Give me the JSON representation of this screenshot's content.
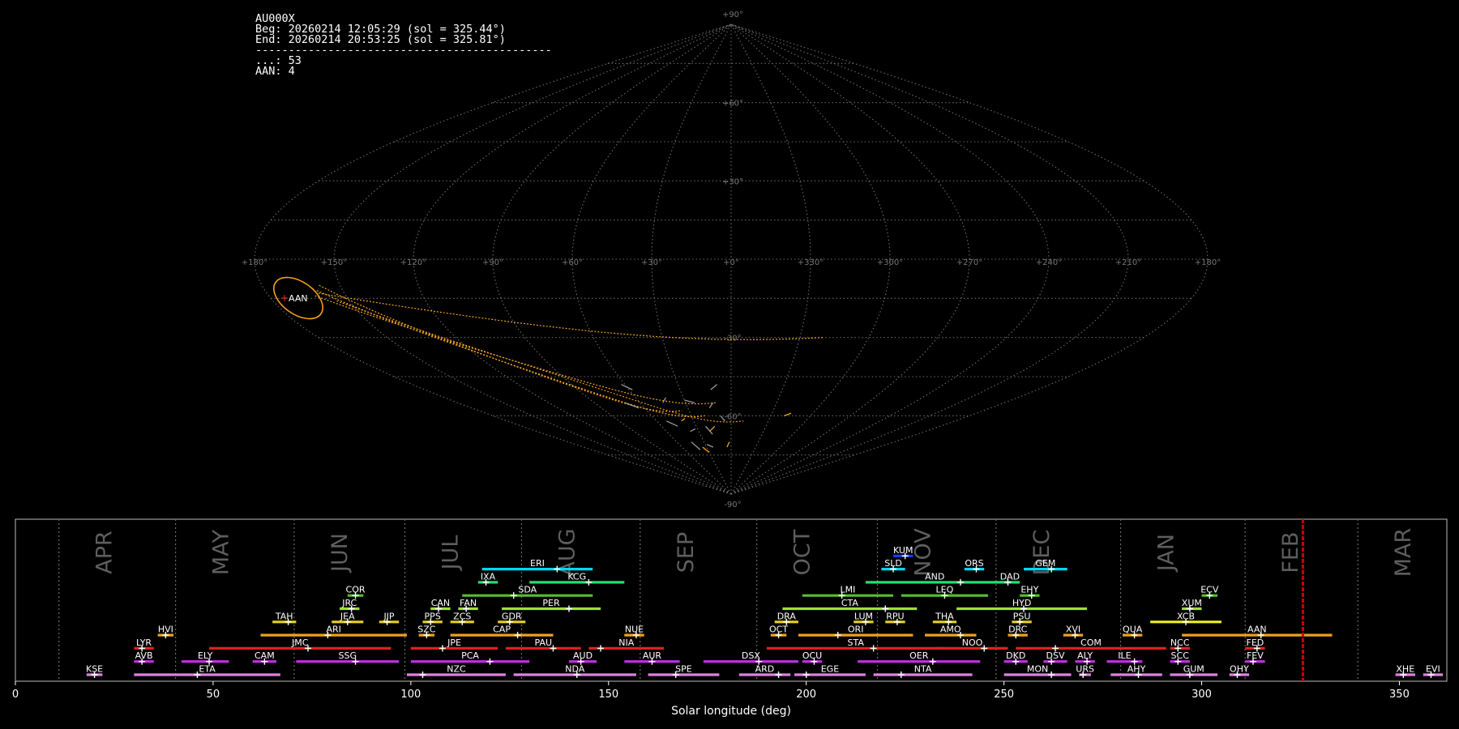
{
  "info": {
    "station": "AU000X",
    "begin": "Beg: 20260214 12:05:29 (sol = 325.44°)",
    "end": "End: 20260214 20:53:25 (sol = 325.81°)",
    "separator": "---------------------------------------------",
    "count_line": "...: 53",
    "shower_line": "AAN: 4"
  },
  "sky_map": {
    "projection": "sinusoidal",
    "lat_labels": [
      "+90°",
      "+60°",
      "+30°",
      "-30°",
      "-60°",
      "-90°"
    ],
    "lon_labels": [
      "+180°",
      "+150°",
      "+120°",
      "+90°",
      "+60°",
      "+30°",
      "+0°",
      "+330°",
      "+300°",
      "+270°",
      "+240°",
      "+210°",
      "+180°"
    ],
    "radiant": {
      "label": "AAN",
      "lon": 157,
      "lat": -12
    },
    "colors": {
      "grid": "#6b6b6b",
      "highlight": "#f0a020",
      "radiant_marker": "#ff3030"
    }
  },
  "chart_data": {
    "type": "timeline",
    "xlabel": "Solar longitude (deg)",
    "xlim": [
      0,
      362
    ],
    "xticks": [
      0,
      50,
      100,
      150,
      200,
      250,
      300,
      350
    ],
    "current_sol": 325.6,
    "months": [
      {
        "label": "APR",
        "start": 11
      },
      {
        "label": "MAY",
        "start": 40.5
      },
      {
        "label": "JUN",
        "start": 70.5
      },
      {
        "label": "JUL",
        "start": 98.5
      },
      {
        "label": "AUG",
        "start": 128
      },
      {
        "label": "SEP",
        "start": 158
      },
      {
        "label": "OCT",
        "start": 187.5
      },
      {
        "label": "NOV",
        "start": 218
      },
      {
        "label": "DEC",
        "start": 248
      },
      {
        "label": "JAN",
        "start": 279.5
      },
      {
        "label": "FEB",
        "start": 311
      },
      {
        "label": "MAR",
        "start": 339.5
      }
    ],
    "showers": [
      {
        "code": "KUM",
        "start": 222,
        "end": 227,
        "peak": 225,
        "row": 9,
        "color": "#1a3cff"
      },
      {
        "code": "ERI",
        "start": 118,
        "end": 146,
        "peak": 137,
        "row": 8,
        "color": "#00d8f0"
      },
      {
        "code": "SLD",
        "start": 219,
        "end": 225,
        "peak": 222,
        "row": 8,
        "color": "#00d8f0"
      },
      {
        "code": "ORS",
        "start": 240,
        "end": 245,
        "peak": 243,
        "row": 8,
        "color": "#00d8f0"
      },
      {
        "code": "GEM",
        "start": 255,
        "end": 266,
        "peak": 262,
        "row": 8,
        "color": "#00d8f0"
      },
      {
        "code": "IXA",
        "start": 117,
        "end": 122,
        "peak": 119,
        "row": 7,
        "color": "#20e070"
      },
      {
        "code": "KCG",
        "start": 130,
        "end": 154,
        "peak": 145,
        "row": 7,
        "color": "#20e070"
      },
      {
        "code": "AND",
        "start": 215,
        "end": 250,
        "peak": 239,
        "row": 7,
        "color": "#20e070"
      },
      {
        "code": "DAD",
        "start": 249,
        "end": 254,
        "peak": 251,
        "row": 7,
        "color": "#20e070"
      },
      {
        "code": "COR",
        "start": 84,
        "end": 88,
        "peak": 86,
        "row": 6,
        "color": "#55c030"
      },
      {
        "code": "SDA",
        "start": 113,
        "end": 146,
        "peak": 126,
        "row": 6,
        "color": "#55c030"
      },
      {
        "code": "LMI",
        "start": 199,
        "end": 222,
        "peak": 209,
        "row": 6,
        "color": "#55c030"
      },
      {
        "code": "LEQ",
        "start": 224,
        "end": 246,
        "peak": 235,
        "row": 6,
        "color": "#55c030"
      },
      {
        "code": "EHY",
        "start": 254,
        "end": 259,
        "peak": 257,
        "row": 6,
        "color": "#55c030"
      },
      {
        "code": "ECV",
        "start": 300,
        "end": 304,
        "peak": 302,
        "row": 6,
        "color": "#55c030"
      },
      {
        "code": "JRC",
        "start": 82,
        "end": 87,
        "peak": 85,
        "row": 5,
        "color": "#a0e030"
      },
      {
        "code": "CAN",
        "start": 105,
        "end": 110,
        "peak": 107,
        "row": 5,
        "color": "#a0e030"
      },
      {
        "code": "FAN",
        "start": 112,
        "end": 117,
        "peak": 114,
        "row": 5,
        "color": "#a0e030"
      },
      {
        "code": "PER",
        "start": 123,
        "end": 148,
        "peak": 140,
        "row": 5,
        "color": "#a0e030"
      },
      {
        "code": "CTA",
        "start": 194,
        "end": 228,
        "peak": 220,
        "row": 5,
        "color": "#a0e030"
      },
      {
        "code": "HYD",
        "start": 238,
        "end": 271,
        "peak": 255,
        "row": 5,
        "color": "#a0e030"
      },
      {
        "code": "XUM",
        "start": 295,
        "end": 300,
        "peak": 297,
        "row": 5,
        "color": "#a0e030"
      },
      {
        "code": "TAH",
        "start": 65,
        "end": 71,
        "peak": 69,
        "row": 4,
        "color": "#e8d020"
      },
      {
        "code": "JEA",
        "start": 80,
        "end": 88,
        "peak": 84,
        "row": 4,
        "color": "#e8d020"
      },
      {
        "code": "JIP",
        "start": 92,
        "end": 97,
        "peak": 94,
        "row": 4,
        "color": "#e8d020"
      },
      {
        "code": "PPS",
        "start": 103,
        "end": 108,
        "peak": 105,
        "row": 4,
        "color": "#e8d020"
      },
      {
        "code": "ZCS",
        "start": 110,
        "end": 116,
        "peak": 113,
        "row": 4,
        "color": "#e8d020"
      },
      {
        "code": "GDR",
        "start": 122,
        "end": 129,
        "peak": 125,
        "row": 4,
        "color": "#e8d020"
      },
      {
        "code": "DRA",
        "start": 192,
        "end": 198,
        "peak": 195,
        "row": 4,
        "color": "#e8d020"
      },
      {
        "code": "LUM",
        "start": 212,
        "end": 217,
        "peak": 215,
        "row": 4,
        "color": "#e8d020"
      },
      {
        "code": "RPU",
        "start": 220,
        "end": 225,
        "peak": 223,
        "row": 4,
        "color": "#e8d020"
      },
      {
        "code": "THA",
        "start": 232,
        "end": 238,
        "peak": 236,
        "row": 4,
        "color": "#e8d020"
      },
      {
        "code": "PSU",
        "start": 252,
        "end": 257,
        "peak": 254,
        "row": 4,
        "color": "#e8d020"
      },
      {
        "code": "XCB",
        "start": 287,
        "end": 305,
        "peak": 296,
        "row": 4,
        "color": "#f0f020"
      },
      {
        "code": "HVI",
        "start": 36,
        "end": 40,
        "peak": 38,
        "row": 3,
        "color": "#f0a020"
      },
      {
        "code": "ARI",
        "start": 62,
        "end": 99,
        "peak": 79,
        "row": 3,
        "color": "#f0a020"
      },
      {
        "code": "SZC",
        "start": 102,
        "end": 106,
        "peak": 104,
        "row": 3,
        "color": "#f0a020"
      },
      {
        "code": "CAP",
        "start": 110,
        "end": 136,
        "peak": 127,
        "row": 3,
        "color": "#f0a020"
      },
      {
        "code": "NUE",
        "start": 154,
        "end": 159,
        "peak": 157,
        "row": 3,
        "color": "#f0a020"
      },
      {
        "code": "OCT",
        "start": 191,
        "end": 195,
        "peak": 193,
        "row": 3,
        "color": "#f0a020"
      },
      {
        "code": "ORI",
        "start": 198,
        "end": 227,
        "peak": 208,
        "row": 3,
        "color": "#f0a020"
      },
      {
        "code": "AMO",
        "start": 230,
        "end": 243,
        "peak": 239,
        "row": 3,
        "color": "#f0a020"
      },
      {
        "code": "DRC",
        "start": 251,
        "end": 256,
        "peak": 253,
        "row": 3,
        "color": "#f0a020"
      },
      {
        "code": "XVI",
        "start": 265,
        "end": 270,
        "peak": 268,
        "row": 3,
        "color": "#f0a020"
      },
      {
        "code": "QUA",
        "start": 280,
        "end": 285,
        "peak": 283,
        "row": 3,
        "color": "#f0a020"
      },
      {
        "code": "AAN",
        "start": 295,
        "end": 333,
        "peak": 315,
        "row": 3,
        "color": "#f0a020"
      },
      {
        "code": "LYR",
        "start": 30,
        "end": 35,
        "peak": 32,
        "row": 2,
        "color": "#e02020"
      },
      {
        "code": "JMC",
        "start": 49,
        "end": 95,
        "peak": 74,
        "row": 2,
        "color": "#e02020"
      },
      {
        "code": "JPE",
        "start": 100,
        "end": 122,
        "peak": 108,
        "row": 2,
        "color": "#e02020"
      },
      {
        "code": "PAU",
        "start": 124,
        "end": 143,
        "peak": 136,
        "row": 2,
        "color": "#e02020"
      },
      {
        "code": "NIA",
        "start": 145,
        "end": 164,
        "peak": 148,
        "row": 2,
        "color": "#e02020"
      },
      {
        "code": "STA",
        "start": 190,
        "end": 235,
        "peak": 217,
        "row": 2,
        "color": "#e02020"
      },
      {
        "code": "NOO",
        "start": 233,
        "end": 251,
        "peak": 245,
        "row": 2,
        "color": "#e02020"
      },
      {
        "code": "COM",
        "start": 253,
        "end": 291,
        "peak": 263,
        "row": 2,
        "color": "#e02020"
      },
      {
        "code": "NCC",
        "start": 292,
        "end": 297,
        "peak": 294,
        "row": 2,
        "color": "#e02020"
      },
      {
        "code": "FED",
        "start": 311,
        "end": 316,
        "peak": 314,
        "row": 2,
        "color": "#e02020"
      },
      {
        "code": "AVB",
        "start": 30,
        "end": 35,
        "peak": 32,
        "row": 1,
        "color": "#c030e0"
      },
      {
        "code": "ELY",
        "start": 42,
        "end": 54,
        "peak": 49,
        "row": 1,
        "color": "#c030e0"
      },
      {
        "code": "CAM",
        "start": 60,
        "end": 66,
        "peak": 63,
        "row": 1,
        "color": "#c030e0"
      },
      {
        "code": "SSG",
        "start": 71,
        "end": 97,
        "peak": 86,
        "row": 1,
        "color": "#c030e0"
      },
      {
        "code": "PCA",
        "start": 100,
        "end": 130,
        "peak": 120,
        "row": 1,
        "color": "#c030e0"
      },
      {
        "code": "AUD",
        "start": 140,
        "end": 147,
        "peak": 143,
        "row": 1,
        "color": "#c030e0"
      },
      {
        "code": "AUR",
        "start": 154,
        "end": 168,
        "peak": 161,
        "row": 1,
        "color": "#c030e0"
      },
      {
        "code": "DSX",
        "start": 174,
        "end": 198,
        "peak": 188,
        "row": 1,
        "color": "#c030e0"
      },
      {
        "code": "OCU",
        "start": 199,
        "end": 204,
        "peak": 202,
        "row": 1,
        "color": "#c030e0"
      },
      {
        "code": "OER",
        "start": 213,
        "end": 244,
        "peak": 232,
        "row": 1,
        "color": "#c030e0"
      },
      {
        "code": "DKD",
        "start": 250,
        "end": 256,
        "peak": 253,
        "row": 1,
        "color": "#c030e0"
      },
      {
        "code": "DSV",
        "start": 260,
        "end": 266,
        "peak": 262,
        "row": 1,
        "color": "#c030e0"
      },
      {
        "code": "ALY",
        "start": 268,
        "end": 273,
        "peak": 271,
        "row": 1,
        "color": "#c030e0"
      },
      {
        "code": "ILE",
        "start": 276,
        "end": 285,
        "peak": 283,
        "row": 1,
        "color": "#c030e0"
      },
      {
        "code": "SCC",
        "start": 292,
        "end": 297,
        "peak": 294,
        "row": 1,
        "color": "#c030e0"
      },
      {
        "code": "FEV",
        "start": 311,
        "end": 316,
        "peak": 313,
        "row": 1,
        "color": "#c030e0"
      },
      {
        "code": "KSE",
        "start": 18,
        "end": 22,
        "peak": 20,
        "row": 0,
        "color": "#e080e0"
      },
      {
        "code": "ETA",
        "start": 30,
        "end": 67,
        "peak": 46,
        "row": 0,
        "color": "#e080e0"
      },
      {
        "code": "NZC",
        "start": 99,
        "end": 124,
        "peak": 103,
        "row": 0,
        "color": "#e080e0"
      },
      {
        "code": "NDA",
        "start": 126,
        "end": 157,
        "peak": 142,
        "row": 0,
        "color": "#e080e0"
      },
      {
        "code": "SPE",
        "start": 160,
        "end": 178,
        "peak": 167,
        "row": 0,
        "color": "#e080e0"
      },
      {
        "code": "ARD",
        "start": 183,
        "end": 196,
        "peak": 193,
        "row": 0,
        "color": "#e080e0"
      },
      {
        "code": "EGE",
        "start": 197,
        "end": 215,
        "peak": 200,
        "row": 0,
        "color": "#e080e0"
      },
      {
        "code": "NTA",
        "start": 217,
        "end": 242,
        "peak": 224,
        "row": 0,
        "color": "#e080e0"
      },
      {
        "code": "MON",
        "start": 250,
        "end": 267,
        "peak": 262,
        "row": 0,
        "color": "#e080e0"
      },
      {
        "code": "URS",
        "start": 269,
        "end": 272,
        "peak": 270,
        "row": 0,
        "color": "#e080e0"
      },
      {
        "code": "AHY",
        "start": 277,
        "end": 290,
        "peak": 284,
        "row": 0,
        "color": "#e080e0"
      },
      {
        "code": "GUM",
        "start": 292,
        "end": 304,
        "peak": 297,
        "row": 0,
        "color": "#e080e0"
      },
      {
        "code": "OHY",
        "start": 307,
        "end": 312,
        "peak": 309,
        "row": 0,
        "color": "#e080e0"
      },
      {
        "code": "XHE",
        "start": 349,
        "end": 354,
        "peak": 351,
        "row": 0,
        "color": "#e080e0"
      },
      {
        "code": "EVI",
        "start": 356,
        "end": 361,
        "peak": 358,
        "row": 0,
        "color": "#e080e0"
      }
    ]
  }
}
